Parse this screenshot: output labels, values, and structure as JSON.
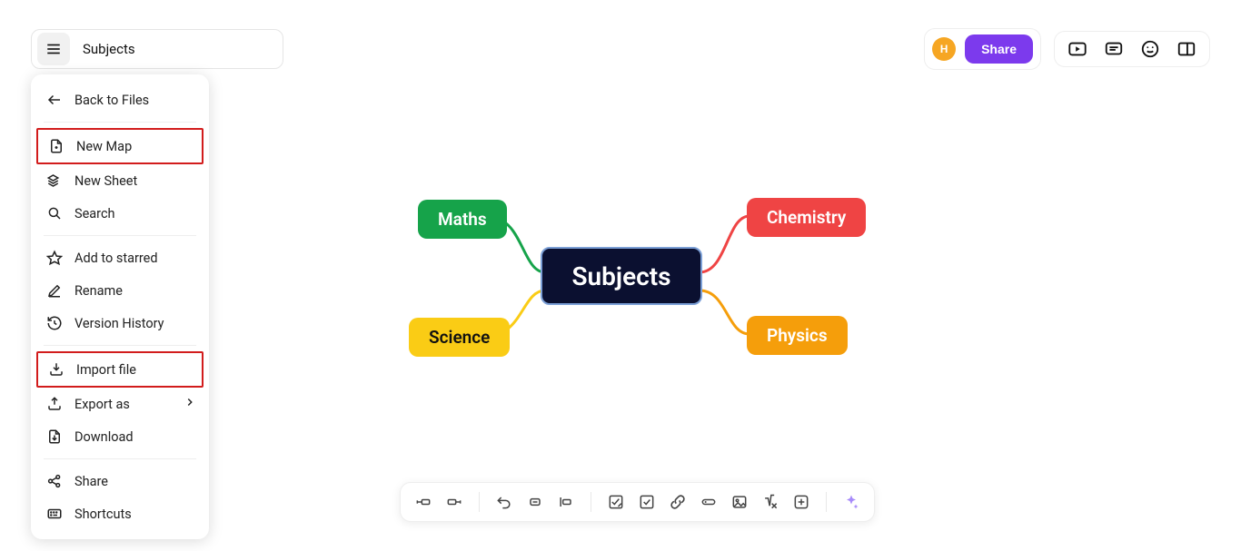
{
  "header": {
    "title": "Subjects",
    "avatar_letter": "H",
    "share_label": "Share"
  },
  "menu": {
    "back_label": "Back to Files",
    "items_file": [
      {
        "id": "new-map",
        "label": "New Map",
        "highlight": true
      },
      {
        "id": "new-sheet",
        "label": "New Sheet"
      },
      {
        "id": "search",
        "label": "Search"
      }
    ],
    "items_edit": [
      {
        "id": "add-starred",
        "label": "Add to starred"
      },
      {
        "id": "rename",
        "label": "Rename"
      },
      {
        "id": "version-history",
        "label": "Version History"
      }
    ],
    "items_io": [
      {
        "id": "import-file",
        "label": "Import file",
        "highlight": true
      },
      {
        "id": "export-as",
        "label": "Export as",
        "has_submenu": true
      },
      {
        "id": "download",
        "label": "Download"
      }
    ],
    "items_extra": [
      {
        "id": "share",
        "label": "Share"
      },
      {
        "id": "shortcuts",
        "label": "Shortcuts"
      }
    ]
  },
  "mindmap": {
    "center": "Subjects",
    "nodes": {
      "maths": "Maths",
      "science": "Science",
      "chemistry": "Chemistry",
      "physics": "Physics"
    },
    "colors": {
      "center_bg": "#0b1030",
      "maths": "#16a34a",
      "science": "#facc15",
      "chemistry": "#ef4444",
      "physics": "#f59e0b"
    }
  },
  "toolbar_bottom": {
    "items": [
      "add-child-left",
      "add-child-right",
      "undo",
      "collapse",
      "align",
      "checklist",
      "checkbox",
      "link",
      "attachment",
      "image",
      "formula",
      "add-box",
      "ai-assist"
    ]
  }
}
